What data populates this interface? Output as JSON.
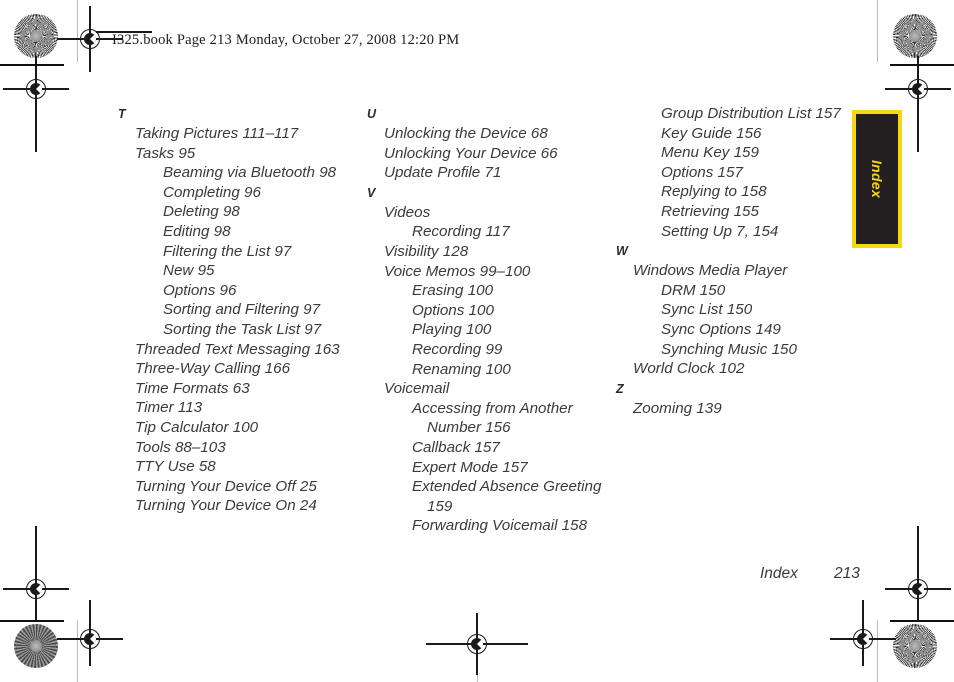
{
  "document": {
    "header_text": "I325.book  Page 213  Monday, October 27, 2008  12:20 PM",
    "footer_label": "Index",
    "footer_page": "213",
    "side_tab_label": "Index",
    "colors": {
      "tab_background": "#231f20",
      "tab_border": "#f5d712",
      "tab_text": "#f5d712",
      "body_text": "#3b3b3b"
    }
  },
  "columns": [
    {
      "id": "column-1",
      "blocks": [
        {
          "letter": "T",
          "entries": [
            {
              "level": 1,
              "text": "Taking Pictures 111–117"
            },
            {
              "level": 1,
              "text": "Tasks 95"
            },
            {
              "level": 2,
              "text": "Beaming via Bluetooth 98"
            },
            {
              "level": 2,
              "text": "Completing 96"
            },
            {
              "level": 2,
              "text": "Deleting 98"
            },
            {
              "level": 2,
              "text": "Editing 98"
            },
            {
              "level": 2,
              "text": "Filtering the List 97"
            },
            {
              "level": 2,
              "text": "New 95"
            },
            {
              "level": 2,
              "text": "Options 96"
            },
            {
              "level": 2,
              "text": "Sorting and Filtering 97"
            },
            {
              "level": 2,
              "text": "Sorting the Task List 97"
            },
            {
              "level": 1,
              "text": "Threaded Text Messaging 163"
            },
            {
              "level": 1,
              "text": "Three-Way Calling 166"
            },
            {
              "level": 1,
              "text": "Time Formats 63"
            },
            {
              "level": 1,
              "text": "Timer 113"
            },
            {
              "level": 1,
              "text": "Tip Calculator 100"
            },
            {
              "level": 1,
              "text": "Tools 88–103"
            },
            {
              "level": 1,
              "text": "TTY Use 58"
            },
            {
              "level": 1,
              "text": "Turning Your Device Off 25"
            },
            {
              "level": 1,
              "text": "Turning Your Device On 24"
            }
          ]
        }
      ]
    },
    {
      "id": "column-2",
      "blocks": [
        {
          "letter": "U",
          "entries": [
            {
              "level": 1,
              "text": "Unlocking the Device 68"
            },
            {
              "level": 1,
              "text": "Unlocking Your Device 66"
            },
            {
              "level": 1,
              "text": "Update Profile 71"
            }
          ]
        },
        {
          "letter": "V",
          "entries": [
            {
              "level": 1,
              "text": "Videos"
            },
            {
              "level": 2,
              "text": "Recording 117"
            },
            {
              "level": 1,
              "text": "Visibility 128"
            },
            {
              "level": 1,
              "text": "Voice Memos 99–100"
            },
            {
              "level": 2,
              "text": "Erasing 100"
            },
            {
              "level": 2,
              "text": "Options 100"
            },
            {
              "level": 2,
              "text": "Playing 100"
            },
            {
              "level": 2,
              "text": "Recording 99"
            },
            {
              "level": 2,
              "text": "Renaming 100"
            },
            {
              "level": 1,
              "text": "Voicemail"
            },
            {
              "level": 2,
              "text": "Accessing from Another"
            },
            {
              "level": 3,
              "text": "Number 156"
            },
            {
              "level": 2,
              "text": "Callback 157"
            },
            {
              "level": 2,
              "text": "Expert Mode 157"
            },
            {
              "level": 2,
              "text": "Extended Absence Greeting"
            },
            {
              "level": 3,
              "text": "159"
            },
            {
              "level": 2,
              "text": "Forwarding Voicemail 158"
            }
          ]
        }
      ]
    },
    {
      "id": "column-3",
      "blocks": [
        {
          "letter": "",
          "entries": [
            {
              "level": 2,
              "text": "Group Distribution List 157"
            },
            {
              "level": 2,
              "text": "Key Guide 156"
            },
            {
              "level": 2,
              "text": "Menu Key 159"
            },
            {
              "level": 2,
              "text": "Options 157"
            },
            {
              "level": 2,
              "text": "Replying to 158"
            },
            {
              "level": 2,
              "text": "Retrieving 155"
            },
            {
              "level": 2,
              "text": "Setting Up 7, 154"
            }
          ]
        },
        {
          "letter": "W",
          "entries": [
            {
              "level": 1,
              "text": "Windows Media Player"
            },
            {
              "level": 2,
              "text": "DRM 150"
            },
            {
              "level": 2,
              "text": "Sync List 150"
            },
            {
              "level": 2,
              "text": "Sync Options 149"
            },
            {
              "level": 2,
              "text": "Synching Music 150"
            },
            {
              "level": 1,
              "text": "World Clock 102"
            }
          ]
        },
        {
          "letter": "Z",
          "entries": [
            {
              "level": 1,
              "text": "Zooming 139"
            }
          ]
        }
      ]
    }
  ]
}
